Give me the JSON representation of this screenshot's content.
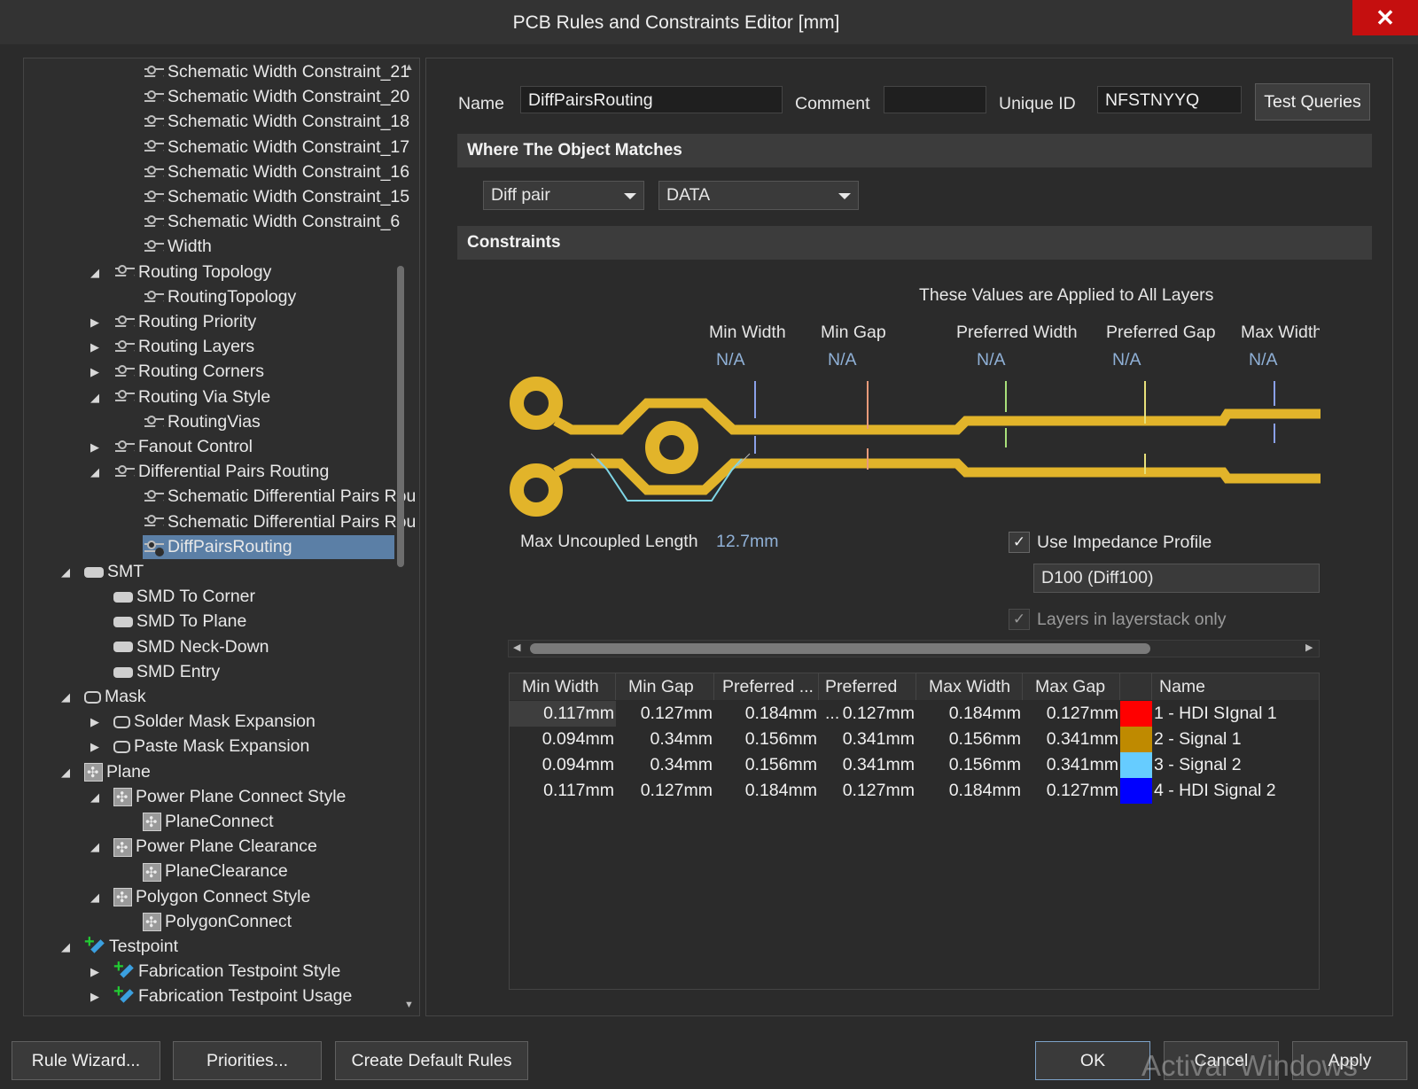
{
  "window": {
    "title": "PCB Rules and Constraints Editor [mm]",
    "close_glyph": "✕"
  },
  "tree": {
    "items": [
      {
        "label": "Schematic Width Constraint_21",
        "icon": "rule-icon"
      },
      {
        "label": "Schematic Width Constraint_20",
        "icon": "rule-icon"
      },
      {
        "label": "Schematic Width Constraint_18",
        "icon": "rule-icon"
      },
      {
        "label": "Schematic Width Constraint_17",
        "icon": "rule-icon"
      },
      {
        "label": "Schematic Width Constraint_16",
        "icon": "rule-icon"
      },
      {
        "label": "Schematic Width Constraint_15",
        "icon": "rule-icon"
      },
      {
        "label": "Schematic Width Constraint_6",
        "icon": "rule-icon"
      },
      {
        "label": "Width",
        "icon": "rule-icon"
      },
      {
        "label": "Routing Topology",
        "icon": "rule-icon",
        "expand": "expanded"
      },
      {
        "label": "RoutingTopology",
        "icon": "rule-icon"
      },
      {
        "label": "Routing Priority",
        "icon": "rule-icon",
        "expand": "collapsed"
      },
      {
        "label": "Routing Layers",
        "icon": "rule-icon",
        "expand": "collapsed"
      },
      {
        "label": "Routing Corners",
        "icon": "rule-icon",
        "expand": "collapsed"
      },
      {
        "label": "Routing Via Style",
        "icon": "rule-icon",
        "expand": "expanded"
      },
      {
        "label": "RoutingVias",
        "icon": "rule-icon"
      },
      {
        "label": "Fanout Control",
        "icon": "rule-icon",
        "expand": "collapsed"
      },
      {
        "label": "Differential Pairs Routing",
        "icon": "rule-icon",
        "expand": "expanded"
      },
      {
        "label": "Schematic Differential Pairs Rou",
        "icon": "rule-icon"
      },
      {
        "label": "Schematic Differential Pairs Rou",
        "icon": "rule-icon"
      },
      {
        "label": "DiffPairsRouting",
        "icon": "rule-icon",
        "selected": true
      },
      {
        "label": "SMT",
        "icon": "smt-icon",
        "expand": "expanded"
      },
      {
        "label": "SMD To Corner",
        "icon": "smt-icon"
      },
      {
        "label": "SMD To Plane",
        "icon": "smt-icon"
      },
      {
        "label": "SMD Neck-Down",
        "icon": "smt-icon"
      },
      {
        "label": "SMD Entry",
        "icon": "smt-icon"
      },
      {
        "label": "Mask",
        "icon": "mask-icon",
        "expand": "expanded"
      },
      {
        "label": "Solder Mask Expansion",
        "icon": "mask-icon",
        "expand": "collapsed"
      },
      {
        "label": "Paste Mask Expansion",
        "icon": "mask-icon",
        "expand": "collapsed"
      },
      {
        "label": "Plane",
        "icon": "plane-icon",
        "expand": "expanded"
      },
      {
        "label": "Power Plane Connect Style",
        "icon": "plane-icon",
        "expand": "expanded"
      },
      {
        "label": "PlaneConnect",
        "icon": "plane-icon"
      },
      {
        "label": "Power Plane Clearance",
        "icon": "plane-icon",
        "expand": "expanded"
      },
      {
        "label": "PlaneClearance",
        "icon": "plane-icon"
      },
      {
        "label": "Polygon Connect Style",
        "icon": "plane-icon",
        "expand": "expanded"
      },
      {
        "label": "PolygonConnect",
        "icon": "plane-icon"
      },
      {
        "label": "Testpoint",
        "icon": "testpoint-icon",
        "expand": "expanded"
      },
      {
        "label": "Fabrication Testpoint Style",
        "icon": "testpoint-icon",
        "expand": "collapsed"
      },
      {
        "label": "Fabrication Testpoint Usage",
        "icon": "testpoint-icon",
        "expand": "collapsed"
      }
    ]
  },
  "rule": {
    "name_label": "Name",
    "name_value": "DiffPairsRouting",
    "comment_label": "Comment",
    "comment_value": "",
    "uid_label": "Unique ID",
    "uid_value": "NFSTNYYQ",
    "test_queries": "Test Queries"
  },
  "where": {
    "heading": "Where The Object Matches",
    "scope": "Diff pair",
    "target": "DATA"
  },
  "constraints": {
    "heading": "Constraints",
    "applied_note": "These Values are Applied to All Layers",
    "columns": [
      {
        "title": "Min Width",
        "value": "N/A"
      },
      {
        "title": "Min Gap",
        "value": "N/A"
      },
      {
        "title": "Preferred Width",
        "value": "N/A"
      },
      {
        "title": "Preferred Gap",
        "value": "N/A"
      },
      {
        "title": "Max Width",
        "value": "N/A"
      }
    ],
    "max_uncoupled_label": "Max Uncoupled Length",
    "max_uncoupled_value": "12.7mm",
    "use_impedance_label": "Use Impedance Profile",
    "use_impedance_checked": true,
    "impedance_profile": "D100 (Diff100)",
    "layerstack_only_label": "Layers in layerstack only",
    "layerstack_only_checked": true,
    "check_glyph": "✓",
    "scroll_left": "◀",
    "scroll_right": "▶"
  },
  "layer_table": {
    "headers": [
      "Min Width",
      "Min Gap",
      "Preferred ...",
      "Preferred ...",
      "Max Width",
      "Max Gap",
      "",
      "Name"
    ],
    "rows": [
      {
        "cells": [
          "0.117mm",
          "0.127mm",
          "0.184mm",
          "0.127mm",
          "0.184mm",
          "0.127mm"
        ],
        "color": "#ff0000",
        "name": "1 - HDI SIgnal 1"
      },
      {
        "cells": [
          "0.094mm",
          "0.34mm",
          "0.156mm",
          "0.341mm",
          "0.156mm",
          "0.341mm"
        ],
        "color": "#bf8a00",
        "name": "2 - Signal 1"
      },
      {
        "cells": [
          "0.094mm",
          "0.34mm",
          "0.156mm",
          "0.341mm",
          "0.156mm",
          "0.341mm"
        ],
        "color": "#66ccff",
        "name": "3 - Signal 2"
      },
      {
        "cells": [
          "0.117mm",
          "0.127mm",
          "0.184mm",
          "0.127mm",
          "0.184mm",
          "0.127mm"
        ],
        "color": "#0000ff",
        "name": "4 - HDI Signal 2"
      }
    ]
  },
  "footer": {
    "rule_wizard": "Rule Wizard...",
    "priorities": "Priorities...",
    "create_default": "Create Default Rules",
    "ok": "OK",
    "cancel": "Cancel",
    "apply": "Apply",
    "watermark": "Activar Windows"
  },
  "colors": {
    "trace": "#e2b42a",
    "selection": "#5b7fa6",
    "close": "#c50f0f"
  }
}
